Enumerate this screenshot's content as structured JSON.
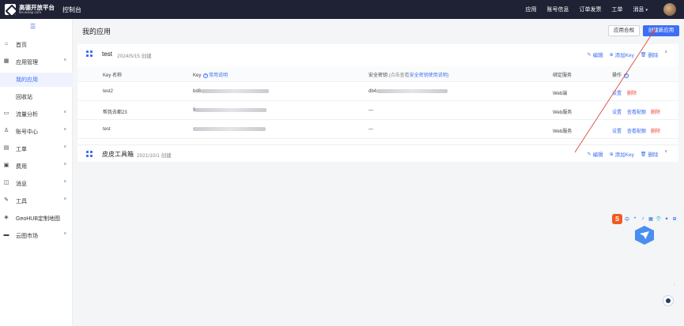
{
  "topbar": {
    "logo_title": "高德开放平台",
    "logo_sub": "lbs.amap.com",
    "console": "控制台",
    "nav": [
      {
        "label": "应用"
      },
      {
        "label": "账号信息"
      },
      {
        "label": "订单发票"
      },
      {
        "label": "工单"
      },
      {
        "label": "消息"
      }
    ]
  },
  "sidebar": {
    "items": [
      {
        "label": "首页",
        "icon": "home-icon",
        "glyph": "⌂",
        "expanded": false
      },
      {
        "label": "应用管理",
        "icon": "apps-icon",
        "glyph": "▦",
        "arrow": "˄"
      },
      {
        "label": "我的应用",
        "sub": true,
        "active": true
      },
      {
        "label": "回收站",
        "sub": true
      },
      {
        "label": "流量分析",
        "icon": "chart-icon",
        "glyph": "▭",
        "arrow": "˅"
      },
      {
        "label": "账号中心",
        "icon": "user-icon",
        "glyph": "♙",
        "arrow": "˅"
      },
      {
        "label": "工单",
        "icon": "ticket-icon",
        "glyph": "▤",
        "arrow": "˅"
      },
      {
        "label": "费用",
        "icon": "billing-icon",
        "glyph": "▣",
        "arrow": "˅"
      },
      {
        "label": "消息",
        "icon": "message-icon",
        "glyph": "◫",
        "arrow": "˅"
      },
      {
        "label": "工具",
        "icon": "tool-icon",
        "glyph": "✎",
        "arrow": "˅"
      },
      {
        "label": "GeoHUB定制地图",
        "icon": "layers-icon",
        "glyph": "◈"
      },
      {
        "label": "云图市场",
        "icon": "market-icon",
        "glyph": "▬",
        "arrow": "˅"
      }
    ]
  },
  "main": {
    "title": "我的应用",
    "compliance_button": "应用合规",
    "create_button": "创建新应用"
  },
  "apps": [
    {
      "name": "test",
      "date": "2024/5/15 创建",
      "actions": {
        "edit": "编辑",
        "add_key": "添加Key",
        "delete": "删除"
      },
      "table": {
        "headers": {
          "key_name": "Key 名称",
          "key": "Key",
          "key_help": "常用说明",
          "secret": "安全密钥",
          "secret_hint": "(点击查看",
          "secret_link": "安全密钥使用说明",
          "secret_end": ")",
          "service": "绑定服务",
          "ops": "操作"
        },
        "rows": [
          {
            "name": "test2",
            "key_prefix": "bd8",
            "secret": "",
            "secret_prefix": "db4",
            "service": "Web端",
            "op1": "设置",
            "op2": "",
            "op3": "删除"
          },
          {
            "name": "帮我去都23",
            "key_prefix": "9",
            "secret": "—",
            "secret_prefix": "",
            "service": "Web服务",
            "op1": "设置",
            "op2": "查看配额",
            "op3": "删除"
          },
          {
            "name": "test",
            "key_prefix": "",
            "secret": "—",
            "secret_prefix": "",
            "service": "Web服务",
            "op1": "设置",
            "op2": "查看配额",
            "op3": "删除"
          }
        ]
      }
    },
    {
      "name": "皮皮工具箱",
      "date": "2021/10/1 创建",
      "actions": {
        "edit": "编辑",
        "add_key": "添加Key",
        "delete": "删除"
      }
    }
  ],
  "float_toolbar": {
    "logo": "S",
    "items": [
      "中",
      "•",
      "♪",
      "▦",
      "👕",
      "✦",
      "⊞"
    ]
  },
  "colors": {
    "primary": "#3d6ef5",
    "danger": "#f0483e",
    "topbar": "#1f2235",
    "annotation": "#d94a3a"
  }
}
